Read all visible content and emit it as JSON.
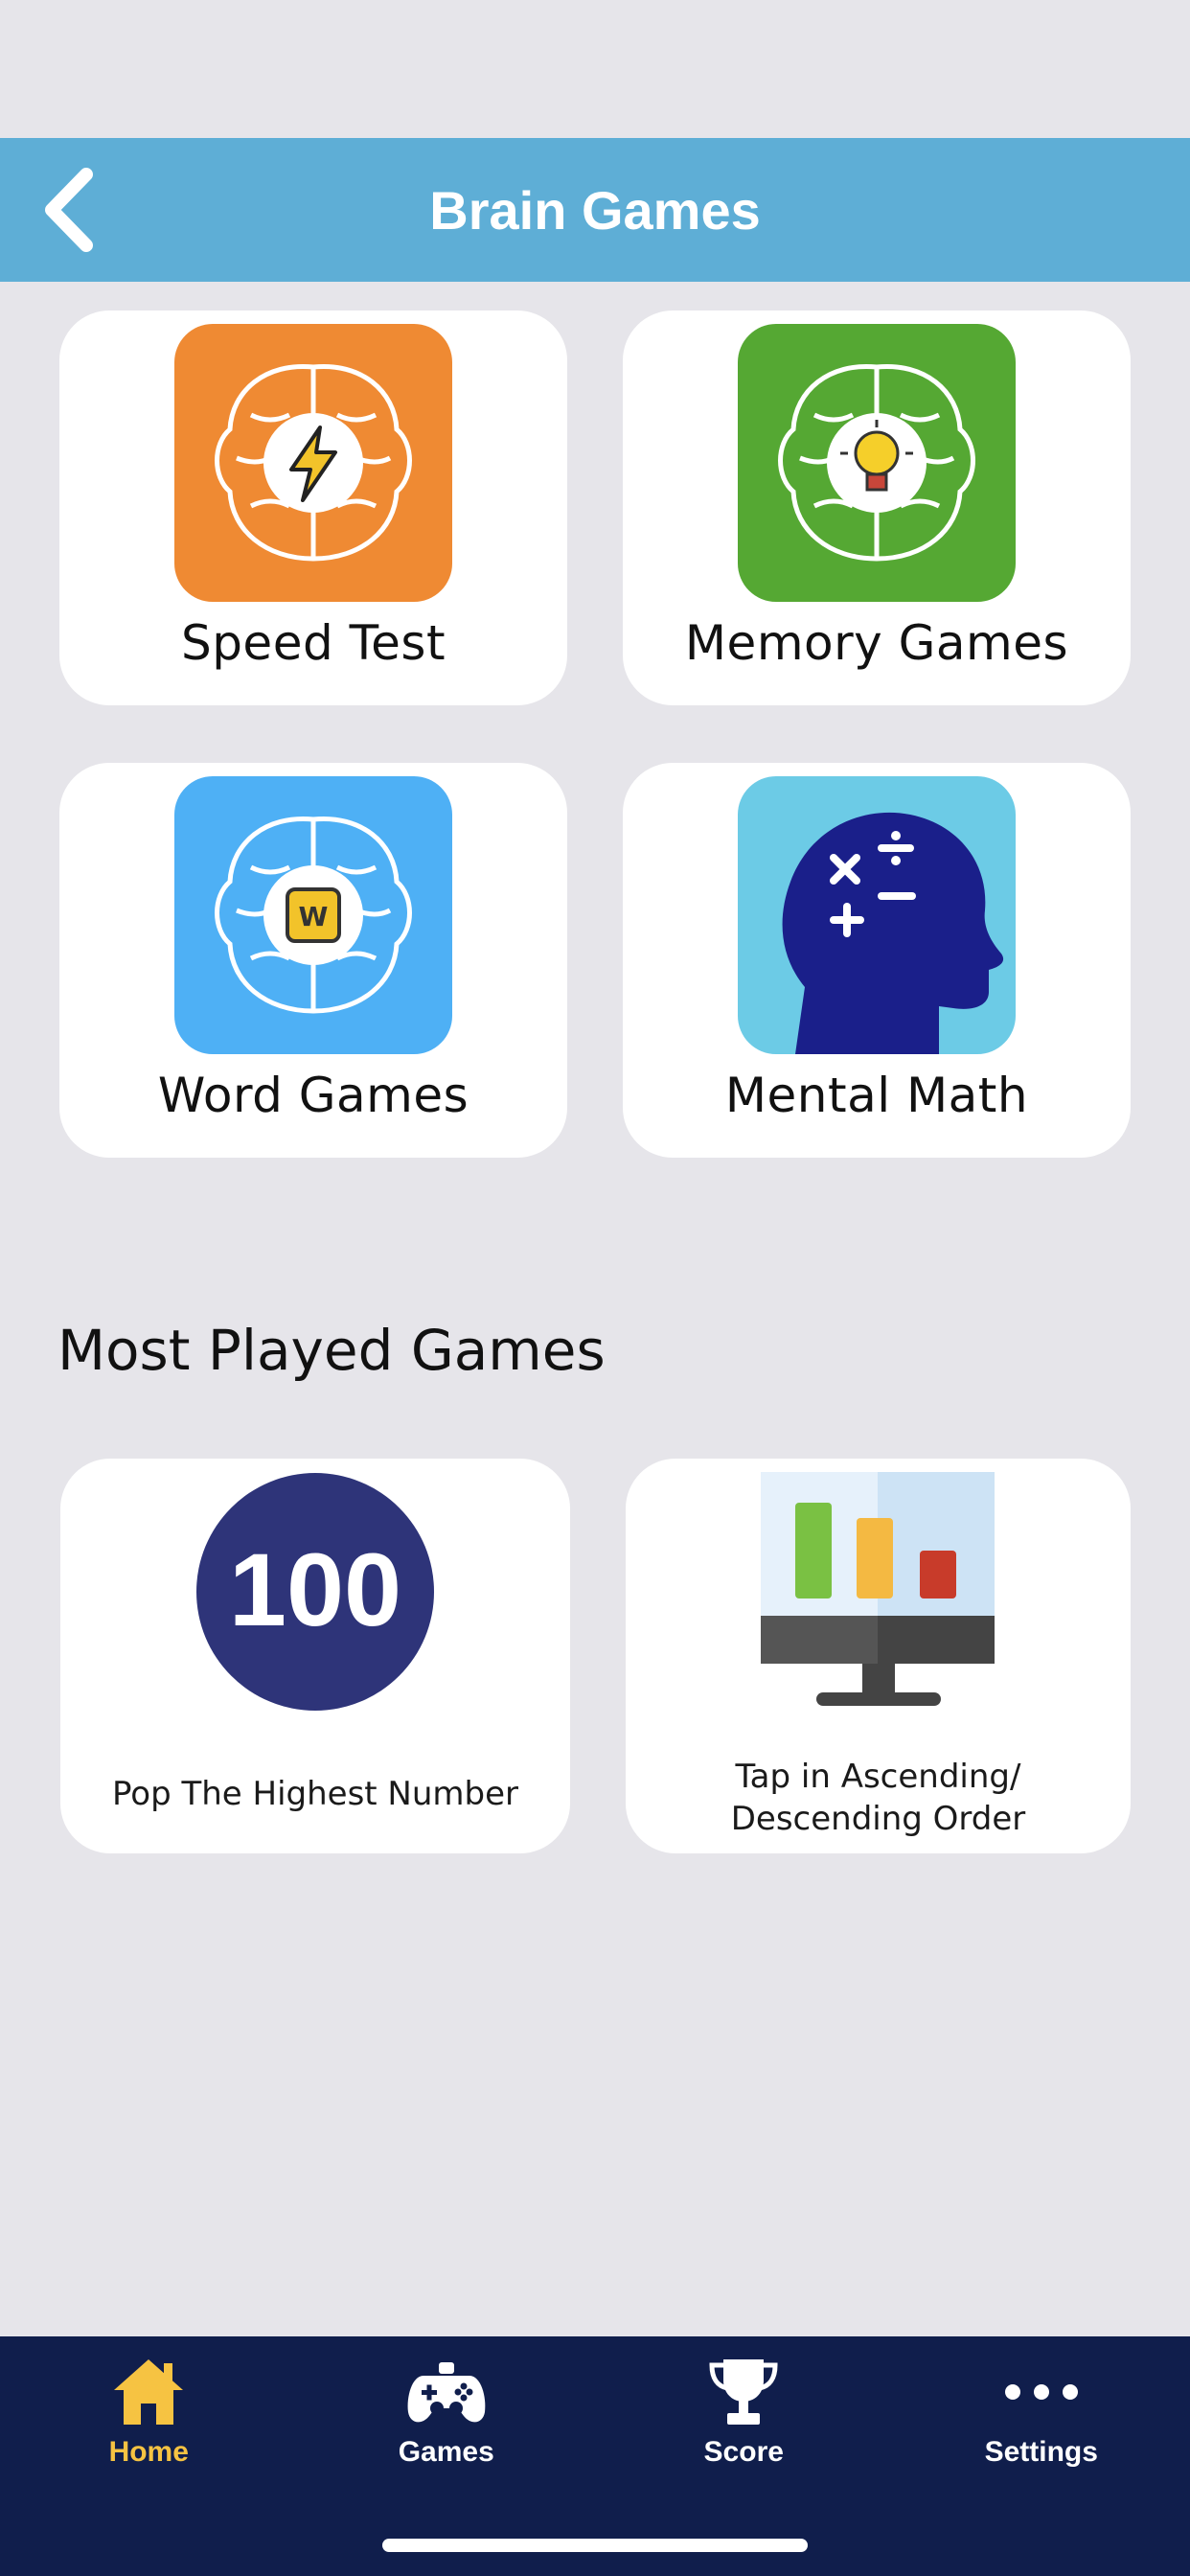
{
  "header": {
    "title": "Brain Games",
    "back_icon": "chevron-left-icon"
  },
  "categories": [
    {
      "label": "Speed Test",
      "icon": "brain-lightning-icon",
      "color": "#ef8a33"
    },
    {
      "label": "Memory Games",
      "icon": "brain-lightbulb-icon",
      "color": "#55a833"
    },
    {
      "label": "Word Games",
      "icon": "brain-letter-w-icon",
      "color": "#4eb0f5"
    },
    {
      "label": "Mental Math",
      "icon": "head-math-symbols-icon",
      "color": "#6ccbe6"
    }
  ],
  "most_played": {
    "title": "Most Played Games",
    "items": [
      {
        "label": "Pop The Highest Number",
        "icon_text": "100",
        "icon": "number-circle-icon"
      },
      {
        "label_line1": "Tap in Ascending/",
        "label_line2": "Descending Order",
        "icon": "bar-chart-monitor-icon"
      }
    ]
  },
  "tabs": [
    {
      "label": "Home",
      "icon": "home-icon",
      "active": true
    },
    {
      "label": "Games",
      "icon": "gamepad-icon",
      "active": false
    },
    {
      "label": "Score",
      "icon": "trophy-icon",
      "active": false
    },
    {
      "label": "Settings",
      "icon": "more-dots-icon",
      "active": false
    }
  ],
  "colors": {
    "header_bg": "#5eaed6",
    "tabbar_bg": "#101e4c",
    "active_tab": "#f6c342",
    "page_bg": "#e6e5ea"
  }
}
